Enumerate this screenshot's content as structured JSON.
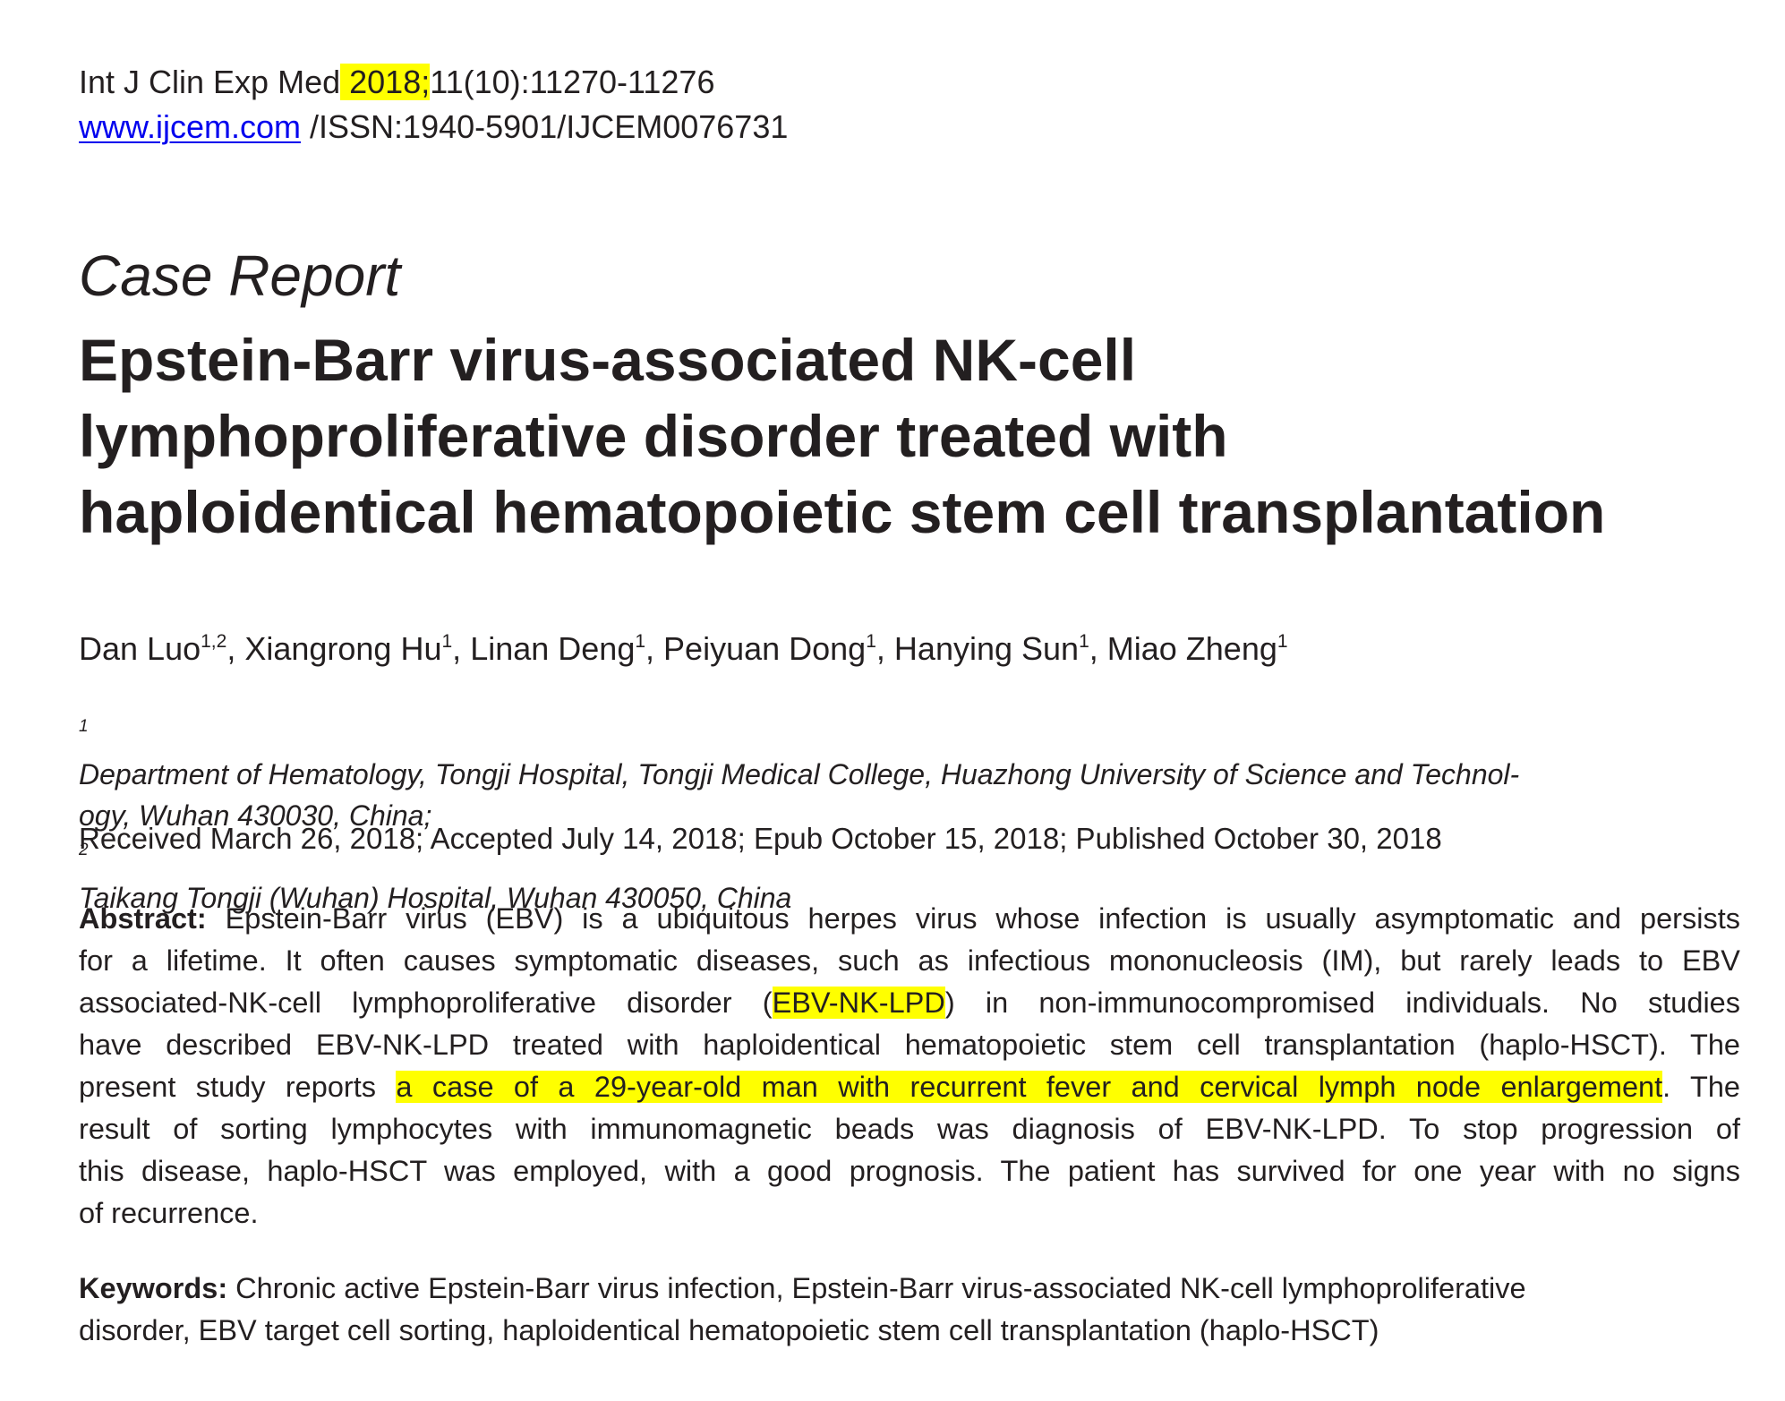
{
  "header": {
    "journal_prefix": "Int J Clin Exp Med",
    "year_highlighted": " 2018;",
    "volume_pages": "11(10):11270-11276",
    "url": "www.ijcem.com",
    "issn": " /ISSN:1940-5901/IJCEM0076731"
  },
  "article": {
    "type": "Case Report",
    "title_lines": [
      "Epstein-Barr virus-associated NK-cell",
      "lymphoproliferative disorder treated with",
      "haploidentical hematopoietic stem cell transplantation"
    ],
    "authors": [
      {
        "name": "Dan Luo",
        "aff": "1,2",
        "sep": ", "
      },
      {
        "name": "Xiangrong Hu",
        "aff": "1",
        "sep": ", "
      },
      {
        "name": "Linan Deng",
        "aff": "1",
        "sep": ", "
      },
      {
        "name": "Peiyuan Dong",
        "aff": "1",
        "sep": ", "
      },
      {
        "name": "Hanying Sun",
        "aff": "1",
        "sep": ", "
      },
      {
        "name": "Miao Zheng",
        "aff": "1",
        "sep": ""
      }
    ],
    "affiliations": {
      "mark1": "1",
      "line1": "Department of Hematology, Tongji Hospital, Tongji Medical College, Huazhong University of Science and Technol-",
      "line2a": "ogy, Wuhan 430030, China; ",
      "mark2": "2",
      "line2b": "Taikang Tongji (Wuhan) Hospital, Wuhan 430050, China"
    },
    "dates": "Received March 26, 2018; Accepted July 14, 2018; Epub October 15, 2018; Published October 30, 2018",
    "abstract": {
      "label": "Abstract:",
      "l1": " Epstein-Barr virus (EBV) is a ubiquitous herpes virus whose infection is usually asymptomatic and persists",
      "l2": "for a lifetime. It often causes symptomatic diseases, such as infectious mononucleosis (IM), but rarely leads to EBV",
      "l3a": "associated-NK-cell lymphoproliferative disorder (",
      "l3hl": "EBV-NK-LPD",
      "l3b": ") in non-immunocompromised individuals. No studies",
      "l4": "have described EBV-NK-LPD treated with haploidentical hematopoietic stem cell transplantation (haplo-HSCT). The",
      "l5a": "present study reports ",
      "l5hl": "a case of a 29-year-old man with recurrent fever and cervical lymph node enlargement",
      "l5b": ". The",
      "l6": "result of sorting lymphocytes with immunomagnetic beads was diagnosis of EBV-NK-LPD. To stop progression of",
      "l7": "this disease, haplo-HSCT was employed, with a good prognosis. The patient has survived for one year with no signs",
      "l8": "of recurrence."
    },
    "keywords": {
      "label": "Keywords:",
      "l1": " Chronic active Epstein-Barr virus infection, Epstein-Barr virus-associated NK-cell lymphoproliferative",
      "l2": "disorder, EBV target cell sorting, haploidentical hematopoietic stem cell transplantation (haplo-HSCT)"
    },
    "highlight_color": "#ffff00",
    "link_color": "#0000ee"
  }
}
